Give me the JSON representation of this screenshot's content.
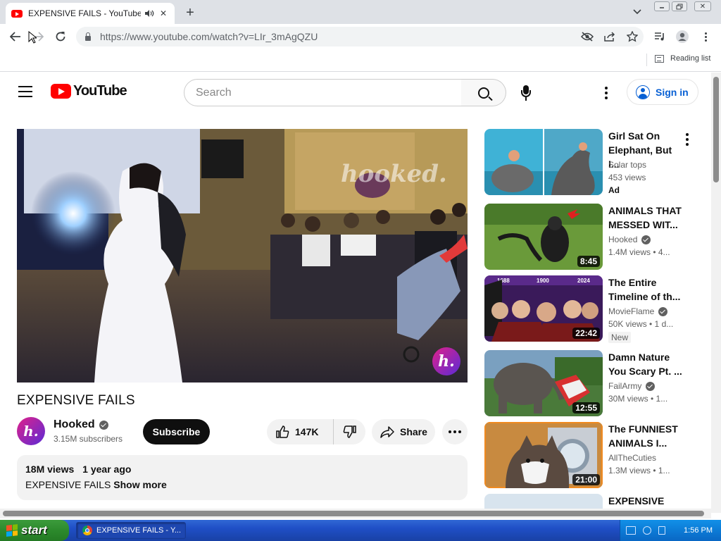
{
  "browser": {
    "tab_title": "EXPENSIVE FAILS - YouTube",
    "url": "https://www.youtube.com/watch?v=LIr_3mAgQZU",
    "reading_list": "Reading list"
  },
  "youtube": {
    "logo_text": "YouTube",
    "search_placeholder": "Search",
    "sign_in": "Sign in"
  },
  "video": {
    "watermark": "hooked.",
    "title": "EXPENSIVE FAILS",
    "channel": {
      "name": "Hooked",
      "subscribers": "3.15M subscribers",
      "avatar_letter": "h."
    },
    "subscribe_label": "Subscribe",
    "likes": "147K",
    "share_label": "Share",
    "description": {
      "views": "18M views",
      "age": "1 year ago",
      "text": "EXPENSIVE FAILS",
      "show_more": "Show more"
    }
  },
  "recommendations": [
    {
      "title_l1": "Girl Sat On",
      "title_l2": "Elephant, But I...",
      "channel": "Solar tops",
      "meta": "453 views",
      "badge": "Ad",
      "duration": ""
    },
    {
      "title_l1": "ANIMALS THAT",
      "title_l2": "MESSED WIT...",
      "channel": "Hooked",
      "meta": "1.4M views • 4...",
      "badge": "",
      "duration": "8:45"
    },
    {
      "title_l1": "The Entire",
      "title_l2": "Timeline of th...",
      "channel": "MovieFlame",
      "meta": "50K views • 1 d...",
      "badge": "New",
      "duration": "22:42",
      "thumb_labels": [
        "1688",
        "1900",
        "2024"
      ]
    },
    {
      "title_l1": "Damn Nature",
      "title_l2": "You Scary Pt. ...",
      "channel": "FailArmy",
      "meta": "30M views • 1...",
      "badge": "",
      "duration": "12:55"
    },
    {
      "title_l1": "The FUNNIEST",
      "title_l2": "ANIMALS I...",
      "channel": "AllTheCuties",
      "meta": "1.3M views • 1...",
      "badge": "",
      "duration": "21:00"
    },
    {
      "title_l1": "EXPENSIVE",
      "title_l2": "",
      "channel": "",
      "meta": "",
      "badge": "",
      "duration": ""
    }
  ],
  "taskbar": {
    "start_label": "start",
    "window_label": "EXPENSIVE FAILS - Y...",
    "time": "1:56 PM"
  },
  "colors": {
    "youtube_red": "#ff0000",
    "link_blue": "#065fd4",
    "xp_taskbar": "#245edb",
    "xp_start_green": "#3c9b3c"
  }
}
